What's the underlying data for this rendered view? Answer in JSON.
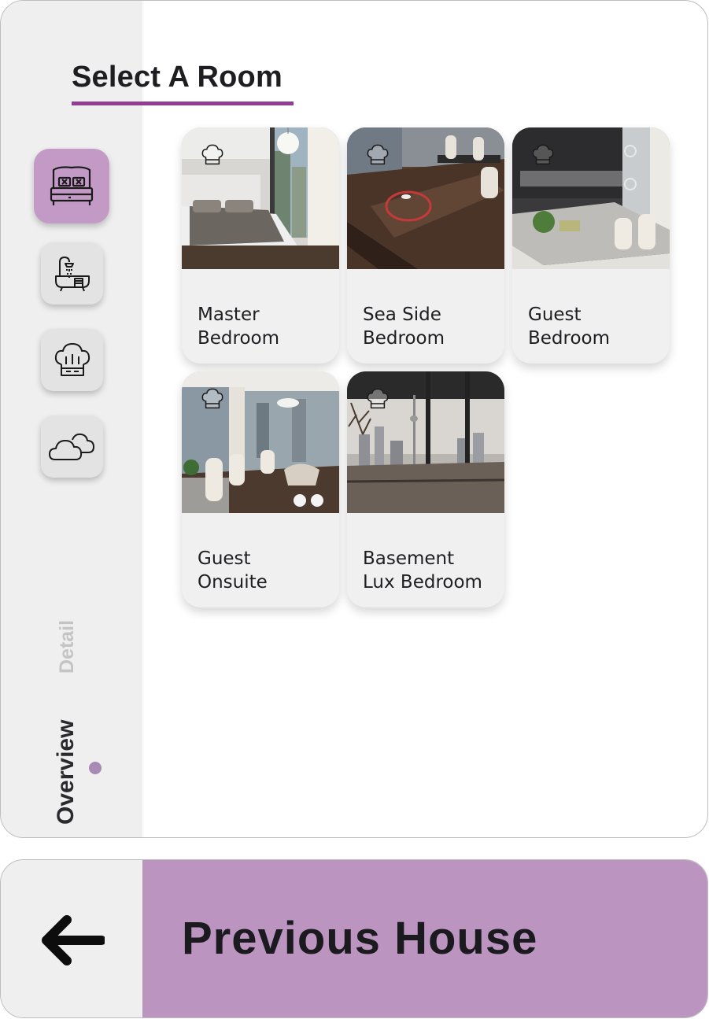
{
  "header": {
    "title": "Select A Room"
  },
  "categories": [
    {
      "icon": "bed-icon",
      "active": true
    },
    {
      "icon": "bathtub-icon",
      "active": false
    },
    {
      "icon": "chef-hat-icon",
      "active": false
    },
    {
      "icon": "cloud-icon",
      "active": false
    }
  ],
  "views": {
    "overview": "Overview",
    "detail": "Detail",
    "active": "Overview"
  },
  "rooms": [
    {
      "line1": "Master",
      "line2": "Bedroom"
    },
    {
      "line1": "Sea Side",
      "line2": "Bedroom"
    },
    {
      "line1": "Guest",
      "line2": "Bedroom"
    },
    {
      "line1": "Guest",
      "line2": "Onsuite"
    },
    {
      "line1": "Basement",
      "line2": "Lux Bedroom"
    }
  ],
  "footer": {
    "previous_label": "Previous House",
    "back_icon": "arrow-left-icon"
  },
  "colors": {
    "accent": "#8f3f93",
    "active_tile": "#c39ac6",
    "footer_bg": "#bc94c0",
    "sidebar_bg": "#efefef",
    "indicator_dot": "#a88ab4"
  }
}
